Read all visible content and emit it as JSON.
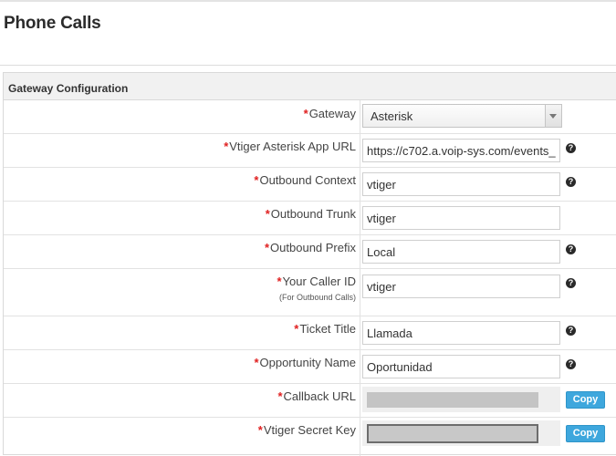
{
  "page": {
    "title": "Phone Calls"
  },
  "panel": {
    "header": "Gateway Configuration"
  },
  "fields": {
    "gateway": {
      "label": "Gateway",
      "value": "Asterisk"
    },
    "app_url": {
      "label": "Vtiger Asterisk App URL",
      "value": "https://c702.a.voip-sys.com/events_"
    },
    "outbound_context": {
      "label": "Outbound Context",
      "value": "vtiger"
    },
    "outbound_trunk": {
      "label": "Outbound Trunk",
      "value": "vtiger"
    },
    "outbound_prefix": {
      "label": "Outbound Prefix",
      "value": "Local"
    },
    "caller_id": {
      "label": "Your Caller ID",
      "sublabel": "(For Outbound Calls)",
      "value": "vtiger"
    },
    "ticket_title": {
      "label": "Ticket Title",
      "value": "Llamada"
    },
    "opportunity_name": {
      "label": "Opportunity Name",
      "value": "Oportunidad"
    },
    "callback_url": {
      "label": "Callback URL",
      "button": "Copy"
    },
    "secret_key": {
      "label": "Vtiger Secret Key",
      "button": "Copy"
    }
  },
  "required_marker": "*",
  "help_glyph": "?",
  "icons": {
    "help": "question-circle-icon",
    "dropdown": "chevron-down-icon"
  },
  "colors": {
    "required": "#e02020",
    "copy_button": "#3ea7dd",
    "header_bg": "#f1f1f1"
  }
}
